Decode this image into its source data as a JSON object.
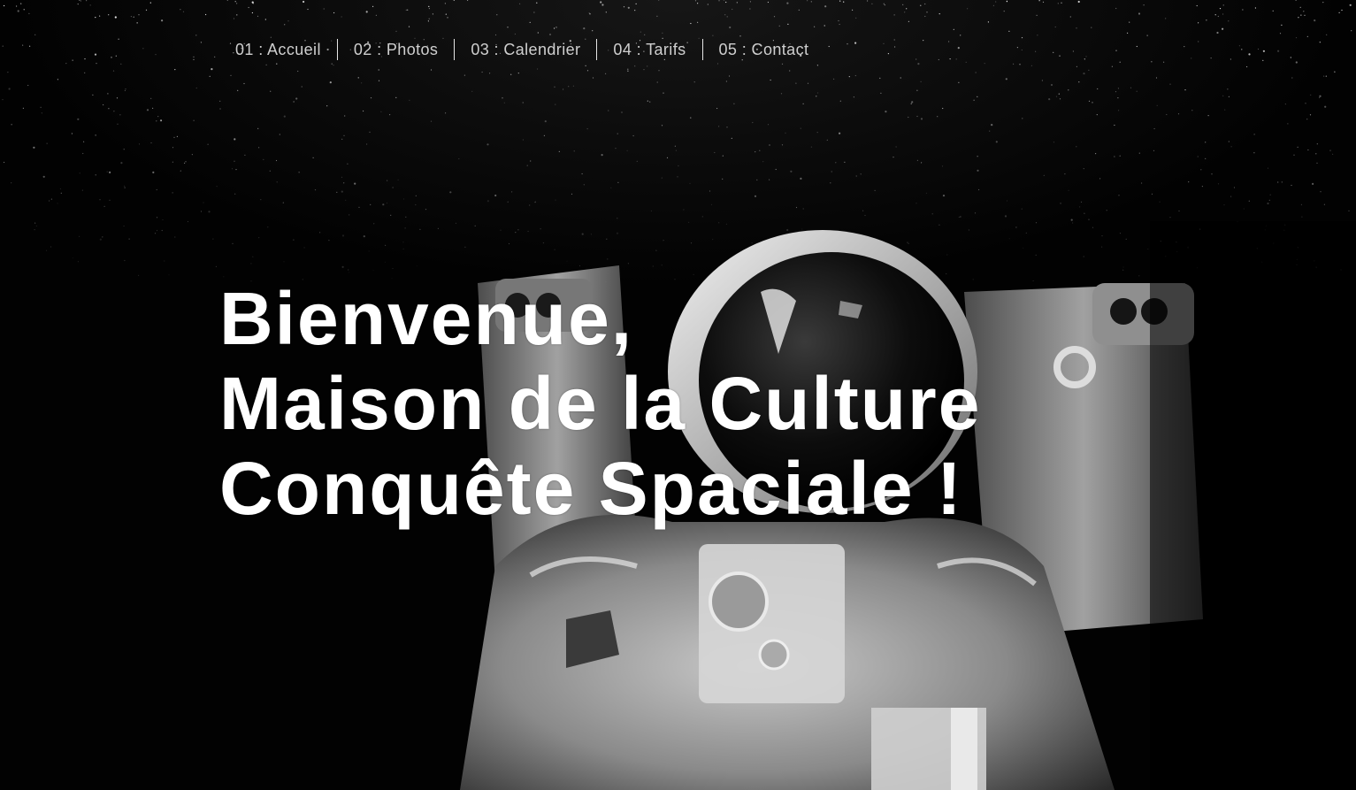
{
  "nav": {
    "items": [
      {
        "label": "01 : Accueil"
      },
      {
        "label": "02 : Photos"
      },
      {
        "label": "03 : Calendrier"
      },
      {
        "label": "04 : Tarifs"
      },
      {
        "label": "05 : Contact"
      }
    ]
  },
  "hero": {
    "line1": "Bienvenue,",
    "line2": "Maison de la Culture",
    "line3": "Conquête Spaciale !"
  },
  "background": {
    "image": "astronaut-photo",
    "palette": [
      "#000000",
      "#ffffff"
    ]
  }
}
